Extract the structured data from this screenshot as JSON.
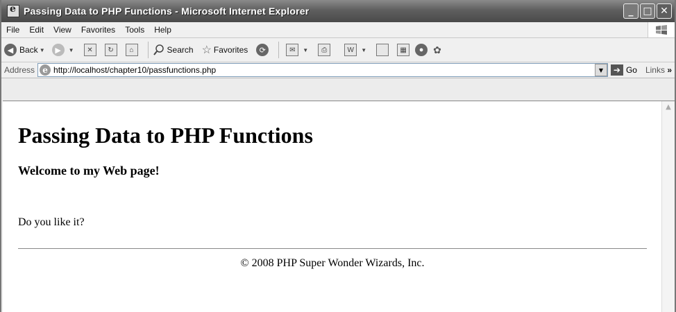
{
  "window": {
    "title": "Passing Data to PHP Functions - Microsoft Internet Explorer",
    "buttons": {
      "minimize": "_",
      "maximize": "□",
      "close": "✕"
    }
  },
  "menubar": {
    "items": [
      "File",
      "Edit",
      "View",
      "Favorites",
      "Tools",
      "Help"
    ]
  },
  "toolbar": {
    "back_label": "Back",
    "search_label": "Search",
    "favorites_label": "Favorites"
  },
  "addressbar": {
    "label": "Address",
    "url": "http://localhost/chapter10/passfunctions.php",
    "go_label": "Go",
    "links_label": "Links",
    "links_chevron": "»"
  },
  "page": {
    "heading": "Passing Data to PHP Functions",
    "subheading": "Welcome to my Web page!",
    "question": "Do you like it?",
    "footer": "© 2008 PHP Super Wonder Wizards, Inc."
  }
}
